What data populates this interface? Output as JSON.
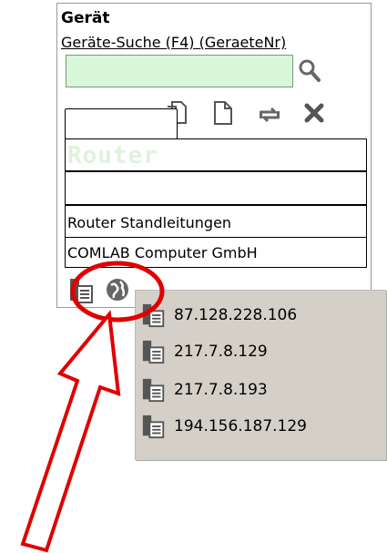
{
  "panel": {
    "title": "Gerät",
    "search_label": "Geräte-Suche (F4) (GeraeteNr)",
    "search_value": "",
    "fields": {
      "name": "Router",
      "empty": "",
      "description": "Router Standleitungen",
      "company": "COMLAB Computer GmbH"
    }
  },
  "dropdown": {
    "items": [
      "87.128.228.106",
      "217.7.8.129",
      "217.7.8.193",
      "194.156.187.129"
    ]
  },
  "annotation": {
    "color": "#e00000"
  }
}
